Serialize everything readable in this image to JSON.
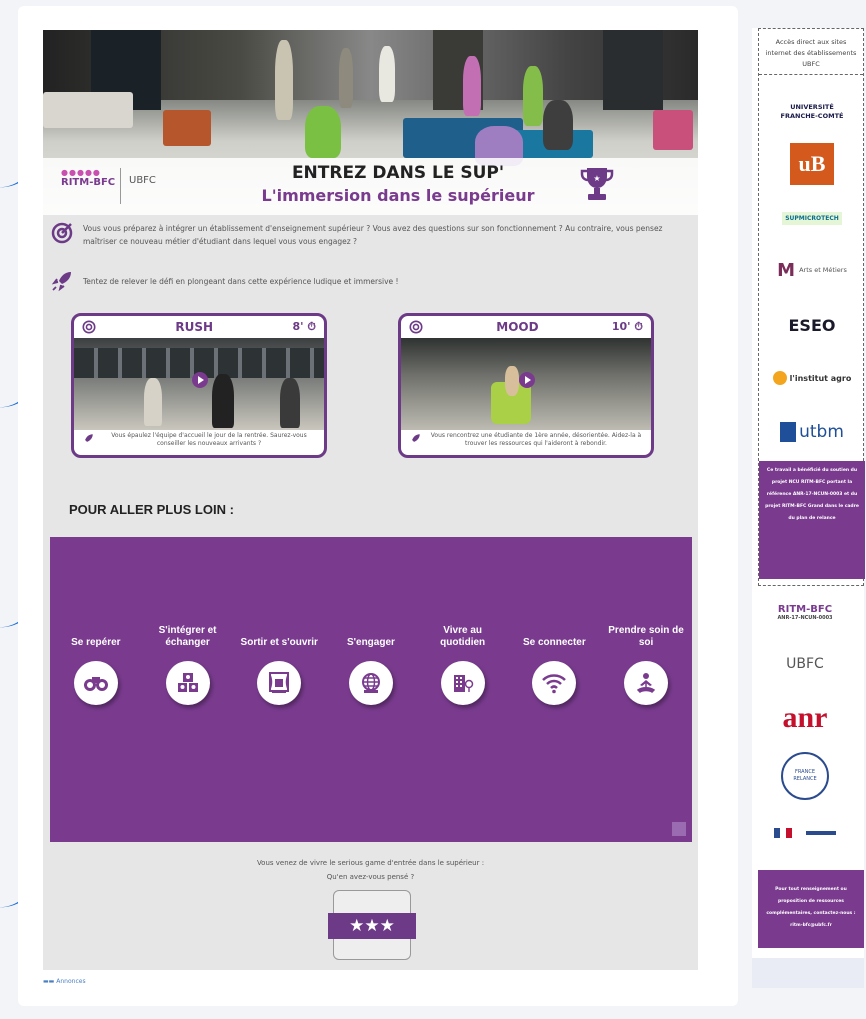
{
  "hero": {
    "title": "ENTREZ DANS LE SUP'",
    "subtitle": "L'immersion dans le supérieur",
    "logo_ritm": "RITM-BFC",
    "logo_ubfc": "UBFC"
  },
  "intro": {
    "text1": "Vous vous préparez à intégrer un établissement d'enseignement supérieur ? Vous avez des questions sur son fonctionnement ? Au contraire, vous pensez maîtriser ce nouveau métier d'étudiant dans lequel vous vous engagez ?",
    "text2": "Tentez de relever le défi en plongeant dans cette expérience ludique et immersive !"
  },
  "games": [
    {
      "name": "RUSH",
      "time": "8'",
      "desc": "Vous épaulez l'équipe d'accueil le jour de la rentrée. Saurez-vous conseiller les nouveaux arrivants ?"
    },
    {
      "name": "MOOD",
      "time": "10'",
      "desc": "Vous rencontrez une étudiante de 1ère année, désorientée. Aidez-la à trouver les ressources qui l'aideront à rebondir."
    }
  ],
  "section": {
    "title": "POUR ALLER PLUS LOIN :"
  },
  "themes": [
    {
      "label": "Se repérer",
      "icon": "binoculars-icon"
    },
    {
      "label": "S'intégrer et échanger",
      "icon": "group-icon"
    },
    {
      "label": "Sortir et s'ouvrir",
      "icon": "theater-icon"
    },
    {
      "label": "S'engager",
      "icon": "globe-icon"
    },
    {
      "label": "Vivre au quotidien",
      "icon": "building-icon"
    },
    {
      "label": "Se connecter",
      "icon": "wifi-icon"
    },
    {
      "label": "Prendre soin de soi",
      "icon": "meditation-icon"
    }
  ],
  "feedback": {
    "line1": "Vous venez de vivre le serious game d'entrée dans le supérieur :",
    "line2": "Qu'en avez-vous pensé ?",
    "stars": "★★★"
  },
  "footer": {
    "link": "Annonces"
  },
  "sidebar": {
    "header": "Accès direct aux sites internet des établissements UBFC",
    "logos": [
      "UNIVERSITÉ FRANCHE-COMTÉ",
      "uB",
      "SUPMICROTECH",
      "Arts et Métiers",
      "ESEO",
      "l'institut agro",
      "utbm"
    ],
    "note1": "Ce travail a bénéficié du soutien du projet NCU RITM-BFC portant la référence ANR-17-NCUN-0003 et du projet RITM-BFC Grand dans le cadre du plan de relance",
    "logo_ritm": "RITM-BFC",
    "logo_ritm_ref": "ANR-17-NCUN-0003",
    "logo_ubfc": "UBFC",
    "logo_anr": "anr",
    "logo_relance": "FRANCE RELANCE",
    "note2": "Pour tout renseignement ou proposition de ressources complémentaires, contactez-nous : ritm-bfc@ubfc.fr"
  },
  "colors": {
    "purple": "#7a3b8f",
    "accent": "#6c3a86",
    "blue": "#1a6fd8"
  }
}
